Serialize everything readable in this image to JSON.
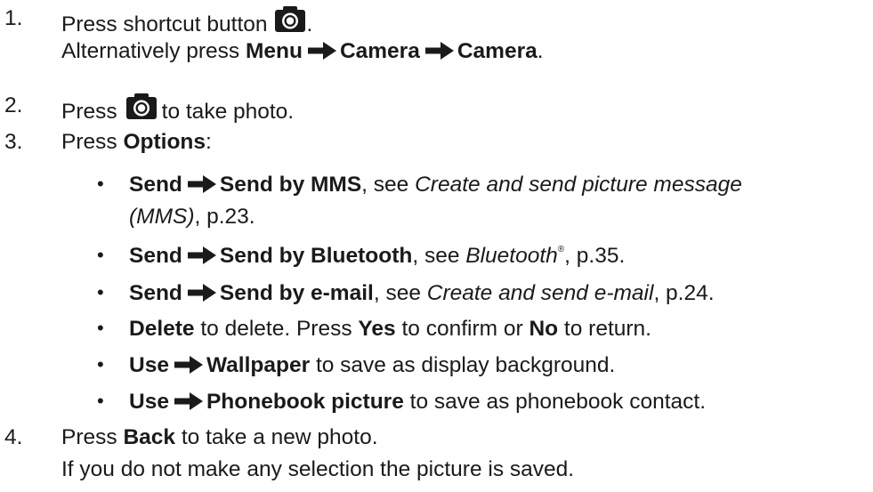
{
  "steps": [
    {
      "num": "1.",
      "line1_pre": "Press shortcut button",
      "line1_post": ".",
      "line2_pre": "Alternatively press",
      "menu": "Menu",
      "camera1": "Camera",
      "camera2": "Camera",
      "line2_post": "."
    },
    {
      "num": "2.",
      "pre": "Press",
      "post": "to take photo."
    },
    {
      "num": "3.",
      "pre": "Press",
      "options": "Options",
      "post": ":"
    },
    {
      "num": "4.",
      "pre": "Press",
      "back": "Back",
      "post": "to take a new photo.",
      "line2": "If you do not make any selection the picture is saved."
    }
  ],
  "bullets": {
    "b1": {
      "send": "Send",
      "target": "Send by MMS",
      "mid": ", see",
      "ref_a": "Create and send picture message",
      "ref_b": "(MMS)",
      "page": ", p.23."
    },
    "b2": {
      "send": "Send",
      "target": "Send by Bluetooth",
      "mid": ", see",
      "ref": "Bluetooth",
      "reg": "®",
      "page": ", p.35."
    },
    "b3": {
      "send": "Send",
      "target": "Send by e-mail",
      "mid": ", see",
      "ref": "Create and send e-mail",
      "page": ", p.24."
    },
    "b4": {
      "delete": "Delete",
      "t1": "to delete. Press",
      "yes": "Yes",
      "t2": "to confirm or",
      "no": "No",
      "t3": "to return."
    },
    "b5": {
      "use": "Use",
      "target": "Wallpaper",
      "post": "to save as display background."
    },
    "b6": {
      "use": "Use",
      "target": "Phonebook picture",
      "post": "to save as phonebook contact."
    }
  },
  "bullet_char": "•",
  "icons": {
    "camera": "camera-icon",
    "arrow": "right-arrow-icon"
  },
  "colors": {
    "text": "#1a1a1a",
    "icon": "#1a1a1a"
  }
}
